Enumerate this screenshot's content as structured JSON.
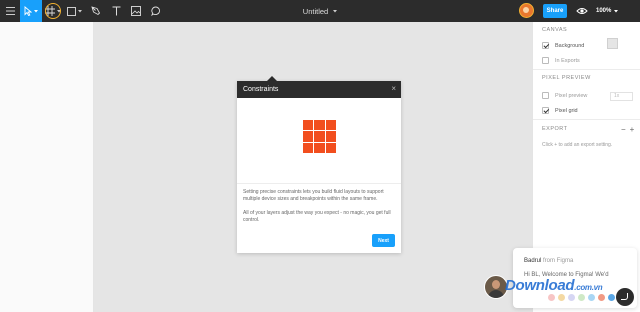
{
  "toolbar": {
    "title": "Untitled",
    "share_label": "Share",
    "zoom": "100%",
    "tools": [
      "menu-icon",
      "move-tool-icon",
      "frame-tool-icon",
      "rectangle-tool-icon",
      "pen-tool-icon",
      "text-tool-icon",
      "image-tool-icon",
      "comment-tool-icon"
    ]
  },
  "right_panel": {
    "canvas_title": "CANVAS",
    "background_label": "Background",
    "in_exports_label": "In Exports",
    "pixel_preview_title": "PIXEL PREVIEW",
    "pixel_preview_label": "Pixel preview",
    "pixel_preview_value": "1x",
    "pixel_grid_label": "Pixel grid",
    "export_title": "EXPORT",
    "export_hint": "Click + to add an export setting."
  },
  "modal": {
    "title": "Constraints",
    "close": "×",
    "paragraph1": "Setting precise constraints lets you build fluid layouts to support multiple device sizes and breakpoints within the same frame.",
    "paragraph2": "All of your layers adjust the way you expect - no magic, you get full control.",
    "next_label": "Next"
  },
  "chat": {
    "sender": "Badrul",
    "sender_suffix": "from Figma",
    "message": "Hi BL, Welcome to Figma! We'd"
  },
  "watermark": {
    "text": "Download",
    "ext": ".com.vn"
  },
  "colors": {
    "accent": "#18a0fb",
    "toolbar": "#2c2c2c",
    "constraint_grid": "#f24e1e",
    "canvas": "#e5e5e5"
  },
  "emoji_dots": [
    "#f7c5c5",
    "#f4d9a3",
    "#d6d6f3",
    "#cfe9c6",
    "#a9d6f4",
    "#f19a84",
    "#5aa7e6"
  ]
}
